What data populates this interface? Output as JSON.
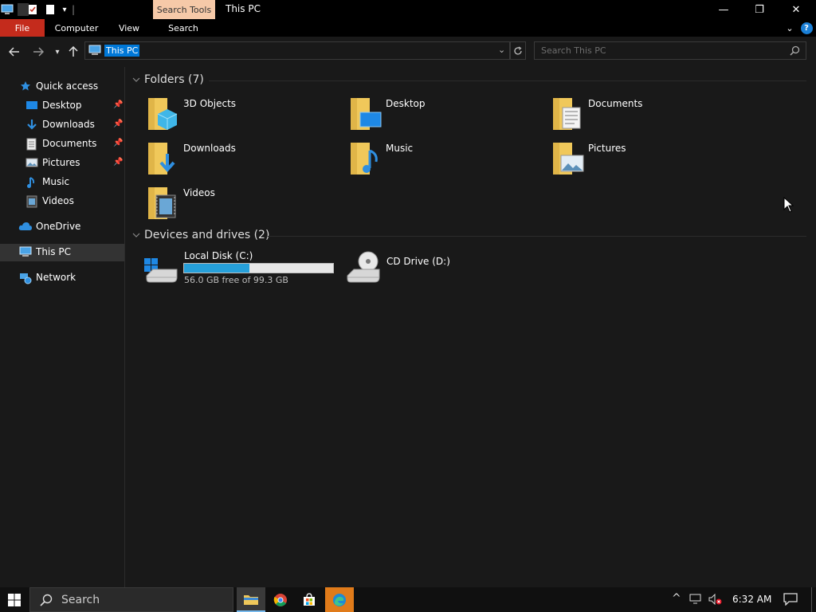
{
  "window": {
    "title": "This PC",
    "context_tab": "Search Tools",
    "controls": {
      "minimize": "—",
      "restore": "❐",
      "close": "✕"
    }
  },
  "ribbon": {
    "tabs": [
      "File",
      "Computer",
      "View",
      "Search"
    ],
    "file_color": "#c42b1c",
    "help": "?"
  },
  "nav": {
    "address_text": "This PC",
    "search_placeholder": "Search This PC"
  },
  "sidebar": {
    "items": [
      {
        "label": "Quick access",
        "icon": "star-icon"
      },
      {
        "label": "Desktop",
        "icon": "desktop-icon",
        "pinned": true
      },
      {
        "label": "Downloads",
        "icon": "download-icon",
        "pinned": true
      },
      {
        "label": "Documents",
        "icon": "document-icon",
        "pinned": true
      },
      {
        "label": "Pictures",
        "icon": "picture-icon",
        "pinned": true
      },
      {
        "label": "Music",
        "icon": "music-icon"
      },
      {
        "label": "Videos",
        "icon": "video-icon"
      },
      {
        "label": "OneDrive",
        "icon": "cloud-icon"
      },
      {
        "label": "This PC",
        "icon": "computer-icon",
        "selected": true
      },
      {
        "label": "Network",
        "icon": "network-icon"
      }
    ]
  },
  "content": {
    "folders_header": "Folders (7)",
    "folders": [
      "3D Objects",
      "Desktop",
      "Documents",
      "Downloads",
      "Music",
      "Pictures",
      "Videos"
    ],
    "devices_header": "Devices and drives (2)",
    "drives": [
      {
        "name": "Local Disk (C:)",
        "free_text": "56.0 GB free of 99.3 GB",
        "used_fraction": 0.436
      },
      {
        "name": "CD Drive (D:)"
      }
    ]
  },
  "taskbar": {
    "search_text": "Search",
    "clock": "6:32 AM"
  },
  "colors": {
    "accent": "#0078d7",
    "drive_fill": "#26a0da",
    "folder": "#f0c85a"
  }
}
